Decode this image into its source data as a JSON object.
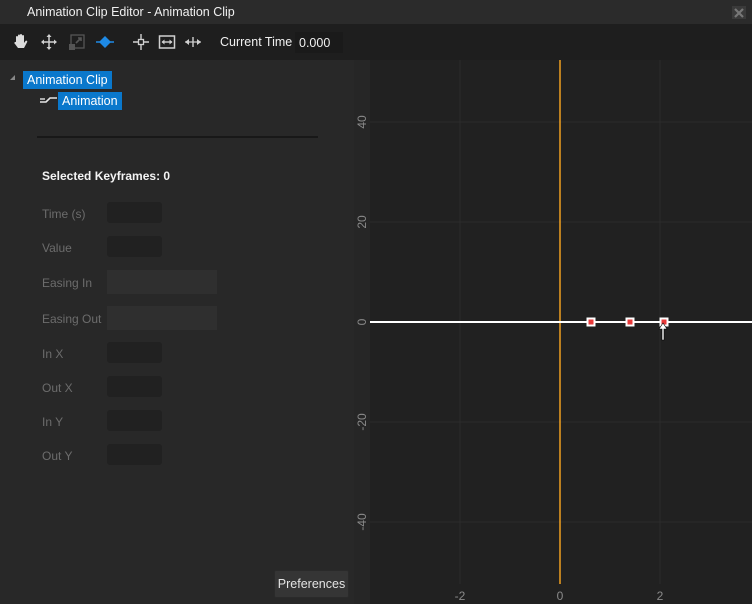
{
  "window": {
    "title": "Animation Clip Editor - Animation Clip",
    "close_icon": "close-icon"
  },
  "toolbar": {
    "tools": [
      {
        "name": "hand-tool",
        "icon": "hand-icon",
        "active": false
      },
      {
        "name": "move-tool",
        "icon": "move-arrows-icon",
        "active": false
      },
      {
        "name": "scale-tool",
        "icon": "scale-icon",
        "active": false,
        "disabled": true
      },
      {
        "name": "keyframe-tool",
        "icon": "keyframe-diamond-icon",
        "active": true
      },
      {
        "name": "frame-selection",
        "icon": "frame-center-icon",
        "active": false
      },
      {
        "name": "fit-horizontal",
        "icon": "fit-horizontal-icon",
        "active": false
      },
      {
        "name": "expand-horizontal",
        "icon": "expand-horizontal-icon",
        "active": false
      }
    ],
    "current_time_label": "Current Time",
    "current_time_value": "0.000"
  },
  "tree": {
    "root": {
      "label": "Animation Clip",
      "expanded": true
    },
    "children": [
      {
        "label": "Animation",
        "icon": "animation-track-icon"
      }
    ]
  },
  "properties": {
    "selected_keyframes_label": "Selected Keyframes: 0",
    "fields": [
      {
        "label": "Time (s)",
        "value": ""
      },
      {
        "label": "Value",
        "value": ""
      },
      {
        "label": "Easing In",
        "value": ""
      },
      {
        "label": "Easing Out",
        "value": ""
      },
      {
        "label": "In X",
        "value": ""
      },
      {
        "label": "Out X",
        "value": ""
      },
      {
        "label": "In Y",
        "value": ""
      },
      {
        "label": "Out Y",
        "value": ""
      }
    ],
    "preferences_label": "Preferences"
  },
  "colors": {
    "accent": "#0a78cc",
    "playhead": "#f0a020",
    "curve": "#ffffff",
    "keyframe_fill": "#e83a3a"
  },
  "graph": {
    "x_ticks": [
      -2,
      0,
      2
    ],
    "y_ticks": [
      40,
      20,
      0,
      -20,
      -40
    ],
    "x_range": [
      -3.8,
      3.8
    ],
    "y_range": [
      -55.5,
      53
    ],
    "playhead_time": 0,
    "keyframes": [
      {
        "time": 0.62,
        "value": 0
      },
      {
        "time": 1.4,
        "value": 0
      },
      {
        "time": 2.08,
        "value": 0
      }
    ],
    "curve_value": 0
  }
}
